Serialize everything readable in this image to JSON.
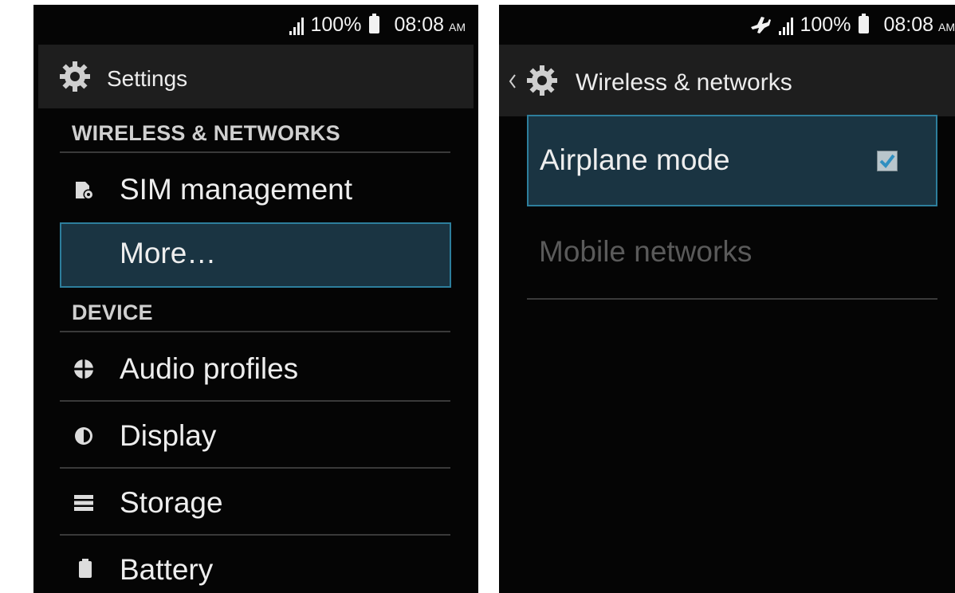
{
  "left_screen": {
    "status": {
      "battery": "100%",
      "time": "08:08",
      "ampm": "AM"
    },
    "title": "Settings",
    "sections": [
      {
        "header": "WIRELESS & NETWORKS",
        "items": [
          {
            "label": "SIM management",
            "icon": "sim-card-icon"
          },
          {
            "label": "More…",
            "selected": true
          }
        ]
      },
      {
        "header": "DEVICE",
        "items": [
          {
            "label": "Audio profiles",
            "icon": "audio-profiles-icon"
          },
          {
            "label": "Display",
            "icon": "display-brightness-icon"
          },
          {
            "label": "Storage",
            "icon": "storage-icon"
          },
          {
            "label": "Battery",
            "icon": "battery-icon"
          }
        ]
      }
    ]
  },
  "right_screen": {
    "status": {
      "battery": "100%",
      "time": "08:08",
      "ampm": "AM"
    },
    "title": "Wireless & networks",
    "items": [
      {
        "label": "Airplane mode",
        "checked": true,
        "selected": true
      },
      {
        "label": "Mobile networks",
        "enabled": false
      }
    ]
  },
  "colors": {
    "background": "#050505",
    "action_bar": "#1e1e1e",
    "selection_fill": "#1a3442",
    "selection_border": "#2d7e9c",
    "disabled_text": "#5a5a5a",
    "checkmark": "#2f8fc0"
  }
}
